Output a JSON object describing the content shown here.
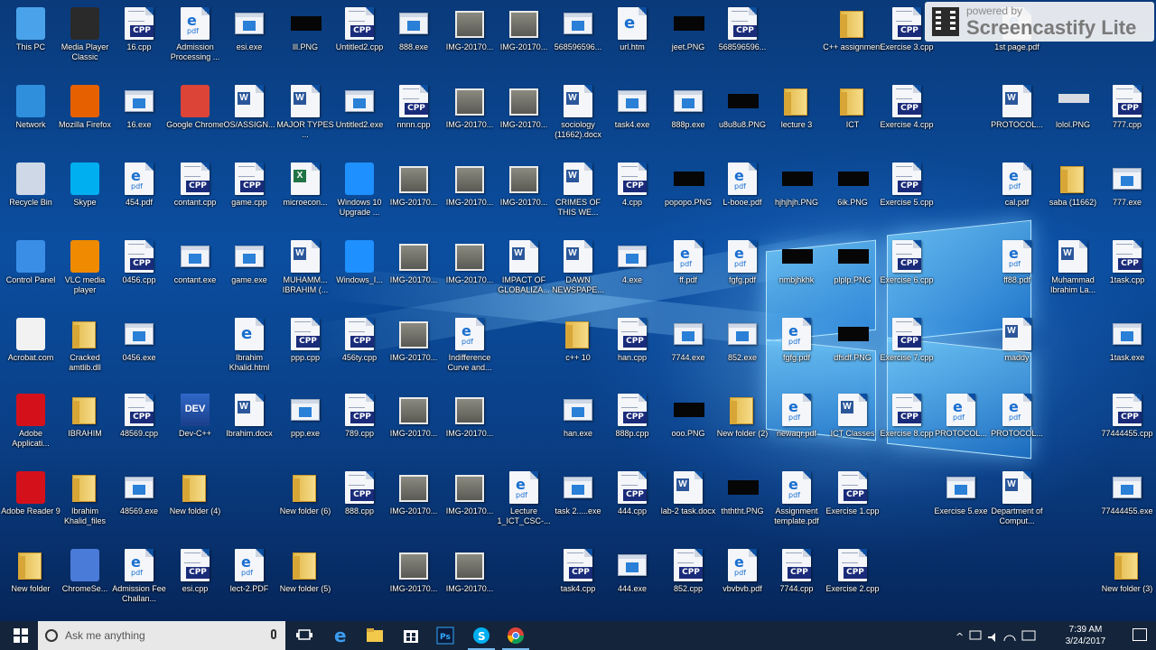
{
  "watermark": {
    "powered_by": "powered by",
    "name": "Screencastify Lite"
  },
  "desktop": {
    "icons": [
      {
        "label": "This PC",
        "type": "sys-pc"
      },
      {
        "label": "Media Player Classic",
        "type": "sys-mpc"
      },
      {
        "label": "16.cpp",
        "type": "cpp"
      },
      {
        "label": "Admission Processing ...",
        "type": "pdf"
      },
      {
        "label": "esi.exe",
        "type": "exe"
      },
      {
        "label": "lll.PNG",
        "type": "black"
      },
      {
        "label": "Untitled2.cpp",
        "type": "cpp"
      },
      {
        "label": "888.exe",
        "type": "exe"
      },
      {
        "label": "IMG-20170...",
        "type": "img"
      },
      {
        "label": "IMG-20170...",
        "type": "img"
      },
      {
        "label": "568596596...",
        "type": "exe"
      },
      {
        "label": "url.htm",
        "type": "html"
      },
      {
        "label": "jeet.PNG",
        "type": "black"
      },
      {
        "label": "568596596...",
        "type": "cpp"
      },
      {
        "label": "C++ assignment",
        "type": "folder"
      },
      {
        "label": "Exercise 3.cpp",
        "type": "cpp"
      },
      {
        "label": "1st page.pdf",
        "type": "pdf"
      },
      {
        "label": "Network",
        "type": "sys-net"
      },
      {
        "label": "Mozilla Firefox",
        "type": "sys-ff"
      },
      {
        "label": "16.exe",
        "type": "exe"
      },
      {
        "label": "Google Chrome",
        "type": "sys-chrome"
      },
      {
        "label": "OS/ASSIGN...",
        "type": "word"
      },
      {
        "label": "MAJOR TYPES ...",
        "type": "word"
      },
      {
        "label": "Untitled2.exe",
        "type": "exe"
      },
      {
        "label": "nnnn.cpp",
        "type": "cpp"
      },
      {
        "label": "IMG-20170...",
        "type": "img"
      },
      {
        "label": "IMG-20170...",
        "type": "img"
      },
      {
        "label": "sociology (11662).docx",
        "type": "word"
      },
      {
        "label": "task4.exe",
        "type": "exe"
      },
      {
        "label": "888p.exe",
        "type": "exe"
      },
      {
        "label": "u8u8u8.PNG",
        "type": "black"
      },
      {
        "label": "lecture 3",
        "type": "folder"
      },
      {
        "label": "ICT",
        "type": "folder"
      },
      {
        "label": "Exercise 4.cpp",
        "type": "cpp"
      },
      {
        "label": "PROTOCOL...",
        "type": "word"
      },
      {
        "label": "lolol.PNG",
        "type": "gray"
      },
      {
        "label": "777.cpp",
        "type": "cpp"
      },
      {
        "label": "Recycle Bin",
        "type": "sys-bin"
      },
      {
        "label": "Skype",
        "type": "sys-skype"
      },
      {
        "label": "454.pdf",
        "type": "pdf"
      },
      {
        "label": "contant.cpp",
        "type": "cpp"
      },
      {
        "label": "game.cpp",
        "type": "cpp"
      },
      {
        "label": "microecon...",
        "type": "xls"
      },
      {
        "label": "Windows 10 Upgrade ...",
        "type": "sys-win10"
      },
      {
        "label": "IMG-20170...",
        "type": "img"
      },
      {
        "label": "IMG-20170...",
        "type": "img"
      },
      {
        "label": "IMG-20170...",
        "type": "img"
      },
      {
        "label": "CRIMES OF THIS WE...",
        "type": "word"
      },
      {
        "label": "4.cpp",
        "type": "cpp"
      },
      {
        "label": "popopo.PNG",
        "type": "black"
      },
      {
        "label": "L-booe.pdf",
        "type": "pdf"
      },
      {
        "label": "hjhjhjh.PNG",
        "type": "black"
      },
      {
        "label": "6ik.PNG",
        "type": "black"
      },
      {
        "label": "Exercise 5.cpp",
        "type": "cpp"
      },
      {
        "label": "cal.pdf",
        "type": "pdf"
      },
      {
        "label": "saba (11662)",
        "type": "folder"
      },
      {
        "label": "777.exe",
        "type": "exe"
      },
      {
        "label": "Control Panel",
        "type": "sys-cp"
      },
      {
        "label": "VLC media player",
        "type": "sys-vlc"
      },
      {
        "label": "0456.cpp",
        "type": "cpp"
      },
      {
        "label": "contant.exe",
        "type": "exe"
      },
      {
        "label": "game.exe",
        "type": "exe"
      },
      {
        "label": "MUHAMM... IBRAHIM (...",
        "type": "word"
      },
      {
        "label": "Windows_I...",
        "type": "sys-win10"
      },
      {
        "label": "IMG-20170...",
        "type": "img"
      },
      {
        "label": "IMG-20170...",
        "type": "img"
      },
      {
        "label": "IMPACT OF GLOBALIZA...",
        "type": "word"
      },
      {
        "label": "DAWN NEWSPAPE...",
        "type": "word"
      },
      {
        "label": "4.exe",
        "type": "exe"
      },
      {
        "label": "ff.pdf",
        "type": "pdf"
      },
      {
        "label": "fgfg.pdf",
        "type": "pdf"
      },
      {
        "label": "nmbjhkhk",
        "type": "black"
      },
      {
        "label": "plplp.PNG",
        "type": "black"
      },
      {
        "label": "Exercise 6.cpp",
        "type": "cpp"
      },
      {
        "label": "ff88.pdf",
        "type": "pdf"
      },
      {
        "label": "Muhammad Ibrahim La...",
        "type": "word"
      },
      {
        "label": "1task.cpp",
        "type": "cpp"
      },
      {
        "label": "Acrobat.com",
        "type": "sys-acro"
      },
      {
        "label": "Cracked amtlib.dll",
        "type": "folder"
      },
      {
        "label": "0456.exe",
        "type": "exe"
      },
      {
        "label": "Ibrahim Khalid.html",
        "type": "html"
      },
      {
        "label": "ppp.cpp",
        "type": "cpp"
      },
      {
        "label": "456ty.cpp",
        "type": "cpp"
      },
      {
        "label": "IMG-20170...",
        "type": "img"
      },
      {
        "label": "Indifference Curve and...",
        "type": "pdf"
      },
      {
        "label": "c++ 10",
        "type": "folder"
      },
      {
        "label": "han.cpp",
        "type": "cpp"
      },
      {
        "label": "7744.exe",
        "type": "exe"
      },
      {
        "label": "852.exe",
        "type": "exe"
      },
      {
        "label": "fgfg.pdf",
        "type": "pdf"
      },
      {
        "label": "dfsdf.PNG",
        "type": "black"
      },
      {
        "label": "Exercise 7.cpp",
        "type": "cpp"
      },
      {
        "label": "maddy",
        "type": "word"
      },
      {
        "label": "1task.exe",
        "type": "exe"
      },
      {
        "label": "Adobe Applicati...",
        "type": "sys-adobe"
      },
      {
        "label": "IBRAHIM",
        "type": "folder"
      },
      {
        "label": "48569.cpp",
        "type": "cpp"
      },
      {
        "label": "Dev-C++",
        "type": "dev"
      },
      {
        "label": "Ibrahim.docx",
        "type": "word"
      },
      {
        "label": "ppp.exe",
        "type": "exe"
      },
      {
        "label": "789.cpp",
        "type": "cpp"
      },
      {
        "label": "IMG-20170...",
        "type": "img"
      },
      {
        "label": "IMG-20170...",
        "type": "img"
      },
      {
        "label": "han.exe",
        "type": "exe"
      },
      {
        "label": "888p.cpp",
        "type": "cpp"
      },
      {
        "label": "ooo.PNG",
        "type": "black"
      },
      {
        "label": "New folder (2)",
        "type": "folder"
      },
      {
        "label": "newaqr.pdf",
        "type": "pdf"
      },
      {
        "label": "ICT Classes",
        "type": "word"
      },
      {
        "label": "Exercise 8.cpp",
        "type": "cpp"
      },
      {
        "label": "PROTOCOL...",
        "type": "pdf"
      },
      {
        "label": "PROTOCOL...",
        "type": "pdf"
      },
      {
        "label": "77444455.cpp",
        "type": "cpp"
      },
      {
        "label": "Adobe Reader 9",
        "type": "sys-adobe"
      },
      {
        "label": "Ibrahim Khalid_files",
        "type": "folder"
      },
      {
        "label": "48569.exe",
        "type": "exe"
      },
      {
        "label": "New folder (4)",
        "type": "folder"
      },
      {
        "label": "New folder (6)",
        "type": "folder"
      },
      {
        "label": "888.cpp",
        "type": "cpp"
      },
      {
        "label": "IMG-20170...",
        "type": "img"
      },
      {
        "label": "IMG-20170...",
        "type": "img"
      },
      {
        "label": "Lecture 1_ICT_CSC-...",
        "type": "pdf"
      },
      {
        "label": "task 2.....exe",
        "type": "exe"
      },
      {
        "label": "444.cpp",
        "type": "cpp"
      },
      {
        "label": "lab-2 task.docx",
        "type": "word"
      },
      {
        "label": "thththt.PNG",
        "type": "black"
      },
      {
        "label": "Assignment template.pdf",
        "type": "pdf"
      },
      {
        "label": "Exercise 1.cpp",
        "type": "cpp"
      },
      {
        "label": "Exercise 5.exe",
        "type": "exe"
      },
      {
        "label": "Department of Comput...",
        "type": "word"
      },
      {
        "label": "77444455.exe",
        "type": "exe"
      },
      {
        "label": "New folder",
        "type": "folder"
      },
      {
        "label": "ChromeSe...",
        "type": "sys-chromese"
      },
      {
        "label": "Admission Fee Challan...",
        "type": "pdf"
      },
      {
        "label": "esi.cpp",
        "type": "cpp"
      },
      {
        "label": "lect-2.PDF",
        "type": "pdf"
      },
      {
        "label": "New folder (5)",
        "type": "folder"
      },
      {
        "label": "IMG-20170...",
        "type": "img"
      },
      {
        "label": "IMG-20170...",
        "type": "img"
      },
      {
        "label": "task4.cpp",
        "type": "cpp"
      },
      {
        "label": "444.exe",
        "type": "exe"
      },
      {
        "label": "852.cpp",
        "type": "cpp"
      },
      {
        "label": "vbvbvb.pdf",
        "type": "pdf"
      },
      {
        "label": "7744.cpp",
        "type": "cpp"
      },
      {
        "label": "Exercise 2.cpp",
        "type": "cpp"
      },
      {
        "label": "New folder (3)",
        "type": "folder"
      }
    ]
  },
  "taskbar": {
    "search_placeholder": "Ask me anything",
    "apps": [
      "task-view",
      "edge",
      "file-explorer",
      "store",
      "photoshop",
      "skype",
      "chrome"
    ],
    "clock_time": "7:39 AM",
    "clock_date": "3/24/2017"
  },
  "colors": {
    "taskbar": "#14243a",
    "accent": "#76b9ed",
    "wallpaper": "#0b4ea0"
  }
}
